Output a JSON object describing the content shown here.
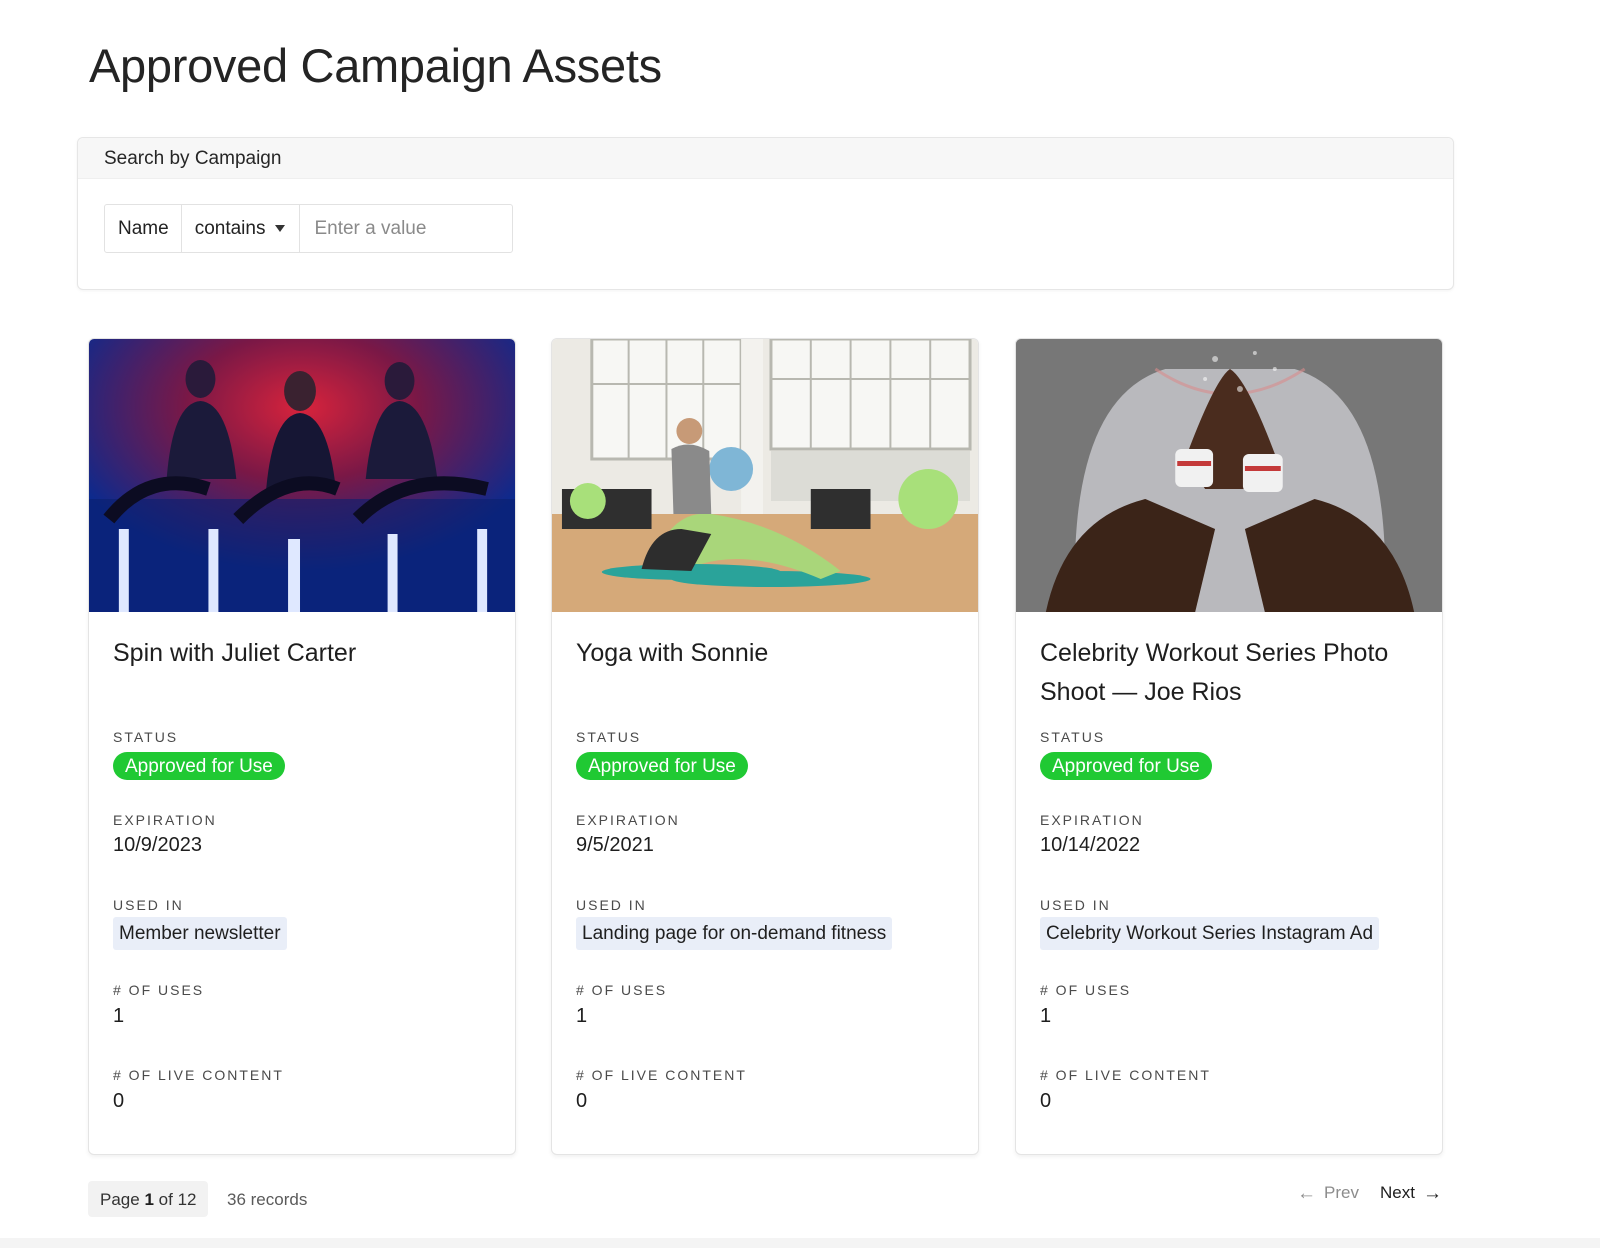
{
  "page": {
    "title": "Approved Campaign Assets"
  },
  "search": {
    "header": "Search by Campaign",
    "field": "Name",
    "operator": "contains",
    "placeholder": "Enter a value",
    "value": ""
  },
  "labels": {
    "status": "STATUS",
    "expiration": "EXPIRATION",
    "used_in": "USED IN",
    "uses": "# OF USES",
    "live_content": "# OF LIVE CONTENT"
  },
  "colors": {
    "approved": "#20c933",
    "chip_bg": "#e9eef8"
  },
  "cards": [
    {
      "title": "Spin with Juliet Carter",
      "image_icon": "spin-class-photo",
      "status": "Approved for Use",
      "expiration": "10/9/2023",
      "used_in": "Member newsletter",
      "uses": "1",
      "live_content": "0"
    },
    {
      "title": "Yoga with Sonnie",
      "image_icon": "yoga-class-photo",
      "status": "Approved for Use",
      "expiration": "9/5/2021",
      "used_in": "Landing page for on-demand fitness",
      "uses": "1",
      "live_content": "0"
    },
    {
      "title": "Celebrity Workout Series Photo Shoot — Joe Rios",
      "image_icon": "workout-photo",
      "status": "Approved for Use",
      "expiration": "10/14/2022",
      "used_in": "Celebrity Workout Series Instagram Ad",
      "uses": "1",
      "live_content": "0"
    }
  ],
  "pagination": {
    "page_label": "Page",
    "current": "1",
    "of_label": "of",
    "total": "12",
    "records": "36 records",
    "prev": "Prev",
    "next": "Next"
  }
}
